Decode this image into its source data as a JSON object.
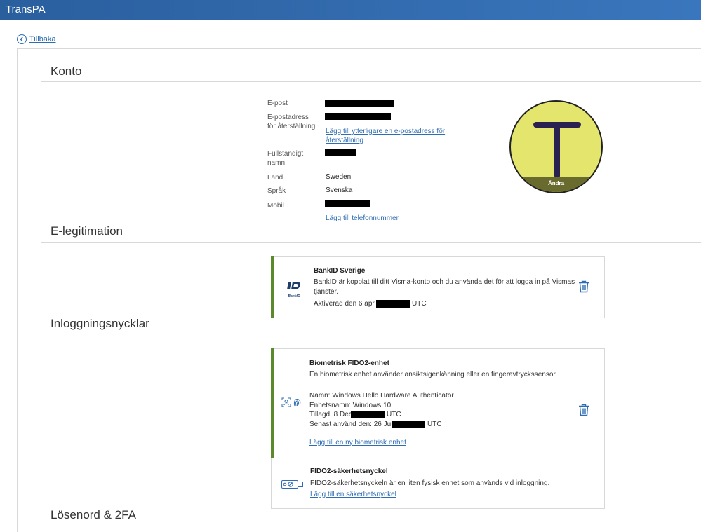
{
  "app": {
    "title": "TransPA"
  },
  "back": {
    "label": "Tillbaka"
  },
  "konto": {
    "title": "Konto",
    "fields": {
      "epost_label": "E-post",
      "reset_email_label_1": "E-postadress",
      "reset_email_label_2": "för återställning",
      "add_reset_email_link_1": "Lägg till ytterligare en e-postadress för",
      "add_reset_email_link_2": "återställning",
      "fullname_label_1": "Fullständigt",
      "fullname_label_2": "namn",
      "country_label": "Land",
      "country_value": "Sweden",
      "language_label": "Språk",
      "language_value": "Svenska",
      "mobile_label": "Mobil",
      "add_phone_link": "Lägg till telefonnummer"
    },
    "avatar": {
      "letter": "T",
      "change_label": "Ändra",
      "bg_color": "#e3e56d",
      "bar_color": "#696b2e"
    }
  },
  "eid": {
    "title": "E-legitimation",
    "bankid": {
      "name": "BankID Sverige",
      "description_1": "BankID är kopplat till ditt Visma-konto och du använda det för att logga in på Vismas",
      "description_2": "tjänster.",
      "activated_prefix": "Aktiverad den 6 apr.",
      "activated_suffix": "UTC",
      "logo_text": "BankID"
    }
  },
  "keys": {
    "title": "Inloggningsnycklar",
    "biometric": {
      "title": "Biometrisk FIDO2-enhet",
      "description": "En biometrisk enhet använder ansiktsigenkänning eller en fingeravtryckssensor.",
      "name_line": "Namn: Windows Hello Hardware Authenticator",
      "device_line": "Enhetsnamn: Windows 10",
      "added_prefix": "Tillagd: 8 Dec",
      "added_suffix": "UTC",
      "last_used_prefix": "Senast använd den: 26 Jun",
      "last_used_suffix": "UTC",
      "add_link": "Lägg till en ny biometrisk enhet"
    },
    "security_key": {
      "title": "FIDO2-säkerhetsnyckel",
      "description": "FIDO2-säkerhetsnyckeln är en liten fysisk enhet som används vid inloggning.",
      "add_link": "Lägg till en säkerhetsnyckel"
    }
  },
  "password": {
    "title": "Lösenord & 2FA"
  },
  "colors": {
    "accent_green": "#5a8a2b",
    "link_blue": "#2e6db3",
    "header_blue": "#2a5f9e"
  }
}
